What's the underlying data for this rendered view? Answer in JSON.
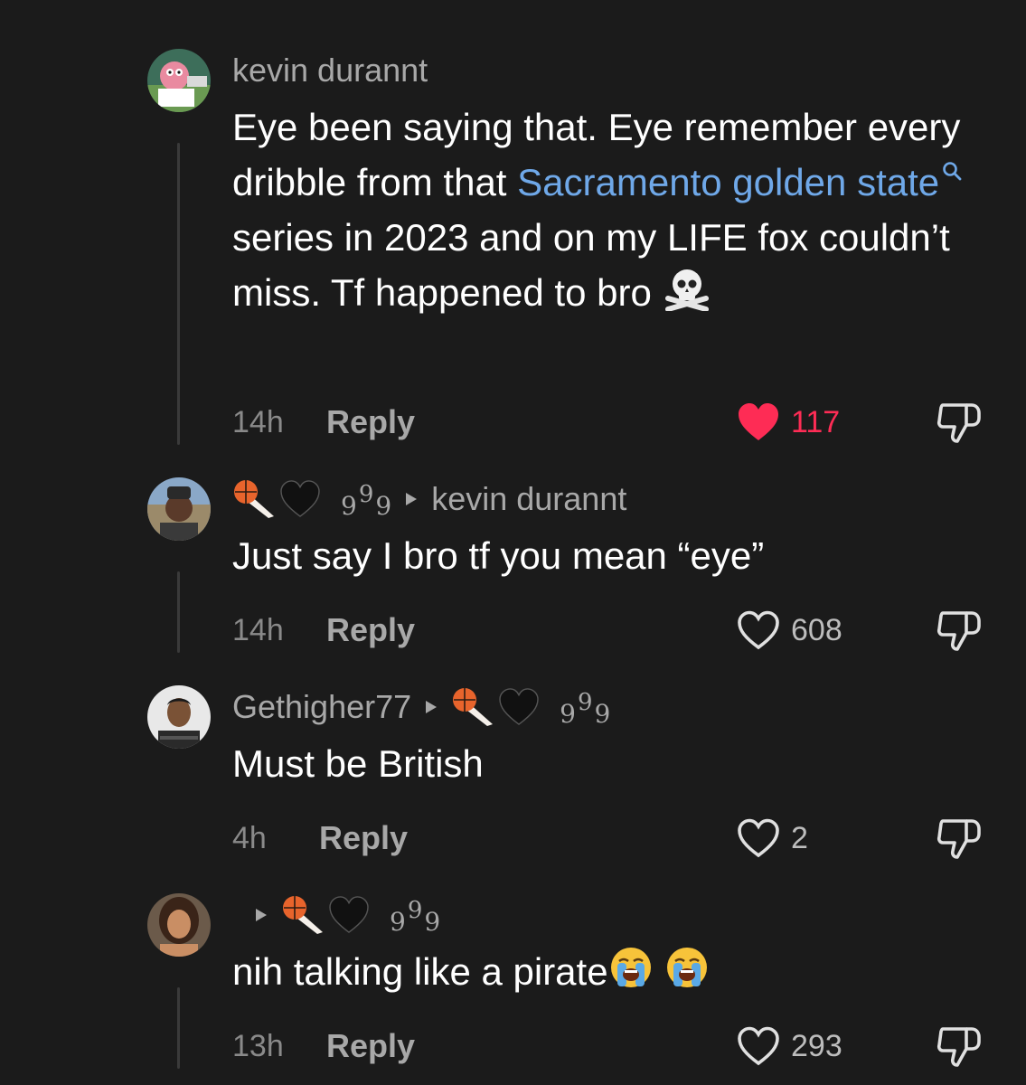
{
  "comments": [
    {
      "username": "kevin durannt",
      "text_parts": [
        "Eye been saying that. Eye remember every dribble from that ",
        "Sacramento golden state",
        " series in 2023 and on my LIFE fox couldn’t miss. Tf happened to bro"
      ],
      "time": "14h",
      "reply_label": "Reply",
      "likes": "117",
      "liked": true
    },
    {
      "username_nines": [
        "9",
        "9",
        "9"
      ],
      "reply_to": "kevin durannt",
      "text": "Just say I bro tf you mean “eye”",
      "time": "14h",
      "reply_label": "Reply",
      "likes": "608"
    },
    {
      "username": "Gethigher77",
      "reply_to_nines": [
        "9",
        "9",
        "9"
      ],
      "text": "Must be British",
      "time": "4h",
      "reply_label": "Reply",
      "likes": "2"
    },
    {
      "reply_to_nines": [
        "9",
        "9",
        "9"
      ],
      "text": "nih talking like a pirate",
      "time": "13h",
      "reply_label": "Reply",
      "likes": "293"
    }
  ],
  "colors": {
    "background": "#1b1b1b",
    "link": "#6fa8e8",
    "like_active": "#fe2c55",
    "muted": "#a8a8a8"
  },
  "icons": [
    "heart-icon",
    "dislike-icon",
    "search-icon",
    "skull-crossbones-emoji",
    "loudly-crying-face-emoji",
    "basketball-emoji",
    "black-heart-emoji",
    "play-arrow-icon"
  ]
}
